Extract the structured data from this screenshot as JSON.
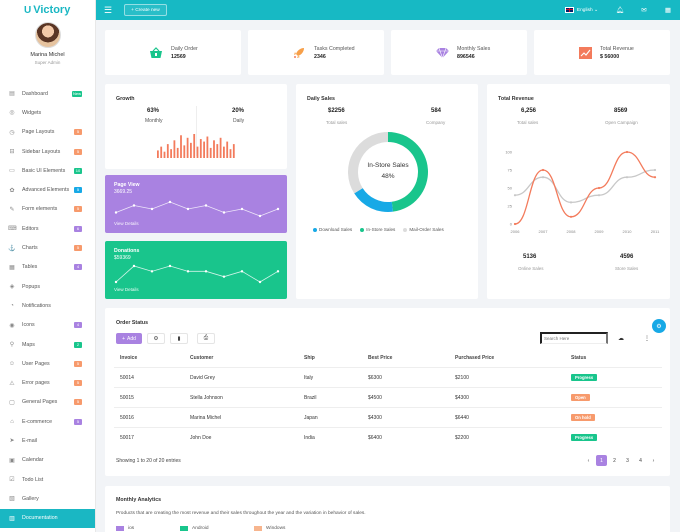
{
  "brand": {
    "name": "Victory",
    "logo_icon": "U"
  },
  "profile": {
    "name": "Marina Michel",
    "role": "Super Admin"
  },
  "sidebar": {
    "items": [
      {
        "label": "Dashboard",
        "icon": "▤",
        "badge": "New",
        "badge_color": "#19c58c"
      },
      {
        "label": "Widgets",
        "icon": "◎",
        "badge": "",
        "badge_color": ""
      },
      {
        "label": "Page Layouts",
        "icon": "◷",
        "badge": "5",
        "badge_color": "#f79a6c"
      },
      {
        "label": "Sidebar Layouts",
        "icon": "⊟",
        "badge": "5",
        "badge_color": "#f79a6c"
      },
      {
        "label": "Basic UI Elements",
        "icon": "▭",
        "badge": "10",
        "badge_color": "#19c58c"
      },
      {
        "label": "Advanced Elements",
        "icon": "✿",
        "badge": "5",
        "badge_color": "#17a9e6"
      },
      {
        "label": "Form elements",
        "icon": "✎",
        "badge": "5",
        "badge_color": "#f79a6c"
      },
      {
        "label": "Editors",
        "icon": "⌨",
        "badge": "6",
        "badge_color": "#a982e1"
      },
      {
        "label": "Charts",
        "icon": "⚓",
        "badge": "5",
        "badge_color": "#f79a6c"
      },
      {
        "label": "Tables",
        "icon": "▦",
        "badge": "4",
        "badge_color": "#a982e1"
      },
      {
        "label": "Popups",
        "icon": "◈",
        "badge": "",
        "badge_color": ""
      },
      {
        "label": "Notifications",
        "icon": "◔",
        "badge": "",
        "badge_color": ""
      },
      {
        "label": "Icons",
        "icon": "◉",
        "badge": "4",
        "badge_color": "#a982e1"
      },
      {
        "label": "Maps",
        "icon": "⚲",
        "badge": "2",
        "badge_color": "#19c58c"
      },
      {
        "label": "User Pages",
        "icon": "☺",
        "badge": "5",
        "badge_color": "#f79a6c"
      },
      {
        "label": "Error pages",
        "icon": "⚠",
        "badge": "5",
        "badge_color": "#f79a6c"
      },
      {
        "label": "General Pages",
        "icon": "▢",
        "badge": "5",
        "badge_color": "#f79a6c"
      },
      {
        "label": "E-commerce",
        "icon": "⌂",
        "badge": "5",
        "badge_color": "#a982e1"
      },
      {
        "label": "E-mail",
        "icon": "➤",
        "badge": "",
        "badge_color": ""
      },
      {
        "label": "Calendar",
        "icon": "▣",
        "badge": "",
        "badge_color": ""
      },
      {
        "label": "Todo List",
        "icon": "☑",
        "badge": "",
        "badge_color": ""
      },
      {
        "label": "Gallery",
        "icon": "▧",
        "badge": "",
        "badge_color": ""
      },
      {
        "label": "Documentation",
        "icon": "▥",
        "badge": "",
        "badge_color": "",
        "active": true
      }
    ]
  },
  "topbar": {
    "create_label": "+ Create new",
    "language": "English ⌄"
  },
  "stats": [
    {
      "label": "Daily Order",
      "value": "12569",
      "icon": "shopping-basket-icon",
      "color": "#19c58c"
    },
    {
      "label": "Tasks Completed",
      "value": "2346",
      "icon": "rocket-icon",
      "color": "#f7a04a"
    },
    {
      "label": "Monthly Sales",
      "value": "896546",
      "icon": "diamond-icon",
      "color": "#a982e1"
    },
    {
      "label": "Total Revenue",
      "value": "$ 56000",
      "icon": "chart-icon",
      "color": "#f37b5c"
    }
  ],
  "growth": {
    "title": "Growth",
    "monthly_value": "63%",
    "monthly_label": "Monthly",
    "daily_value": "20%",
    "daily_label": "Daily",
    "bars": [
      6,
      9,
      5,
      11,
      7,
      14,
      8,
      18,
      10,
      16,
      12,
      19,
      9,
      15,
      13,
      17,
      8,
      14,
      11,
      16,
      9,
      13,
      7,
      11
    ]
  },
  "page_view": {
    "title": "Page View",
    "value": "3669.25",
    "link": "View Details",
    "points": [
      4,
      6,
      5,
      7,
      5,
      6,
      4,
      5,
      3,
      5
    ]
  },
  "donations": {
    "title": "Donations",
    "value": "$59369",
    "link": "View Details",
    "points": [
      3,
      6,
      5,
      6,
      5,
      5,
      4,
      5,
      3,
      5
    ]
  },
  "daily_sales": {
    "title": "Daily Sales",
    "total_value": "$2256",
    "total_label": "Total sales",
    "company_value": "584",
    "company_label": "Company",
    "donut_label": "In-Store Sales",
    "donut_value": "48%",
    "legend": [
      {
        "label": "Download Sales",
        "color": "#17a9e6"
      },
      {
        "label": "In-Store Sales",
        "color": "#19c58c"
      },
      {
        "label": "Mail-Order Sales",
        "color": "#dcdcdc"
      }
    ],
    "chart_data": {
      "type": "pie",
      "labels": [
        "In-Store Sales",
        "Download Sales",
        "Mail-Order Sales"
      ],
      "values": [
        48,
        18,
        34
      ]
    }
  },
  "total_revenue": {
    "title": "Total Revenue",
    "total_value": "6,256",
    "total_label": "Total sales",
    "open_value": "8569",
    "open_label": "Open Campaign",
    "online_value": "5136",
    "online_label": "Online Sales",
    "store_value": "4596",
    "store_label": "Store Sales",
    "chart_data": {
      "type": "line",
      "x": [
        "2006",
        "2007",
        "2008",
        "2009",
        "2010",
        "2011"
      ],
      "ylim": [
        0,
        100
      ],
      "yticks": [
        0,
        25,
        50,
        75,
        100
      ],
      "series": [
        {
          "name": "",
          "color": "#f37b5c",
          "values": [
            0,
            75,
            10,
            50,
            100,
            65
          ]
        },
        {
          "name": "",
          "color": "#c8c8c8",
          "values": [
            40,
            65,
            30,
            40,
            65,
            75
          ]
        }
      ]
    }
  },
  "orders": {
    "title": "Order Status",
    "add_label": "Add",
    "search_placeholder": "Search Here",
    "headers": [
      "Invoice",
      "Customer",
      "Ship",
      "Best Price",
      "Purchased Price",
      "Status"
    ],
    "rows": [
      {
        "invoice": "50014",
        "customer": "David Grey",
        "ship": "Italy",
        "best": "$6300",
        "purchased": "$2100",
        "status": "Progress",
        "status_color": "#19c58c"
      },
      {
        "invoice": "50015",
        "customer": "Stella Johnson",
        "ship": "Brazil",
        "best": "$4500",
        "purchased": "$4300",
        "status": "Open",
        "status_color": "#f79a6c"
      },
      {
        "invoice": "50016",
        "customer": "Marina Michel",
        "ship": "Japan",
        "best": "$4300",
        "purchased": "$6440",
        "status": "On hold",
        "status_color": "#f79a6c"
      },
      {
        "invoice": "50017",
        "customer": "John Doe",
        "ship": "India",
        "best": "$6400",
        "purchased": "$2200",
        "status": "Progress",
        "status_color": "#19c58c"
      }
    ],
    "summary": "Showing 1 to 20 of 20 entries",
    "pages": [
      "‹",
      "1",
      "2",
      "3",
      "4",
      "›"
    ]
  },
  "analytics": {
    "title": "Monthly Analytics",
    "subtitle": "Products that are creating the most revenue and their sales throughout the year and the variation in behavior of sales.",
    "legend": [
      {
        "label": "ios",
        "color": "#a982e1"
      },
      {
        "label": "Android",
        "color": "#19c58c"
      },
      {
        "label": "Windows",
        "color": "#f7b58e"
      }
    ]
  }
}
